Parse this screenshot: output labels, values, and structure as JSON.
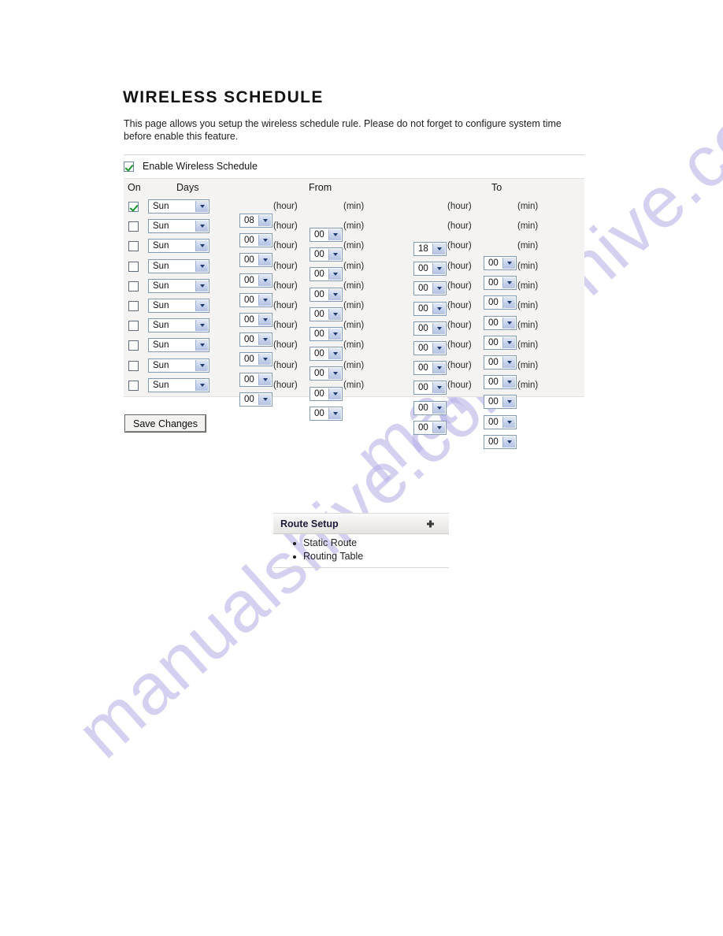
{
  "page": {
    "title": "WIRELESS SCHEDULE",
    "description": "This page allows you setup the wireless schedule rule. Please do not forget to configure system time before enable this feature."
  },
  "enable": {
    "label": "Enable Wireless Schedule",
    "checked": true
  },
  "table": {
    "headers": {
      "on": "On",
      "days": "Days",
      "from": "From",
      "to": "To"
    },
    "unit_hour": "(hour)",
    "unit_min": "(min)",
    "rows": [
      {
        "on": true,
        "day": "Sun",
        "from_hour": "08",
        "from_min": "00",
        "to_hour": "18",
        "to_min": "00"
      },
      {
        "on": false,
        "day": "Sun",
        "from_hour": "00",
        "from_min": "00",
        "to_hour": "00",
        "to_min": "00"
      },
      {
        "on": false,
        "day": "Sun",
        "from_hour": "00",
        "from_min": "00",
        "to_hour": "00",
        "to_min": "00"
      },
      {
        "on": false,
        "day": "Sun",
        "from_hour": "00",
        "from_min": "00",
        "to_hour": "00",
        "to_min": "00"
      },
      {
        "on": false,
        "day": "Sun",
        "from_hour": "00",
        "from_min": "00",
        "to_hour": "00",
        "to_min": "00"
      },
      {
        "on": false,
        "day": "Sun",
        "from_hour": "00",
        "from_min": "00",
        "to_hour": "00",
        "to_min": "00"
      },
      {
        "on": false,
        "day": "Sun",
        "from_hour": "00",
        "from_min": "00",
        "to_hour": "00",
        "to_min": "00"
      },
      {
        "on": false,
        "day": "Sun",
        "from_hour": "00",
        "from_min": "00",
        "to_hour": "00",
        "to_min": "00"
      },
      {
        "on": false,
        "day": "Sun",
        "from_hour": "00",
        "from_min": "00",
        "to_hour": "00",
        "to_min": "00"
      },
      {
        "on": false,
        "day": "Sun",
        "from_hour": "00",
        "from_min": "00",
        "to_hour": "00",
        "to_min": "00"
      }
    ]
  },
  "actions": {
    "save_label": "Save Changes"
  },
  "route_setup": {
    "title": "Route Setup",
    "expand_icon": "plus-icon",
    "items": [
      {
        "label": "Static Route"
      },
      {
        "label": "Routing Table"
      }
    ]
  },
  "watermark": {
    "text": "manualshive.com",
    "color": "#b9b4e8"
  }
}
